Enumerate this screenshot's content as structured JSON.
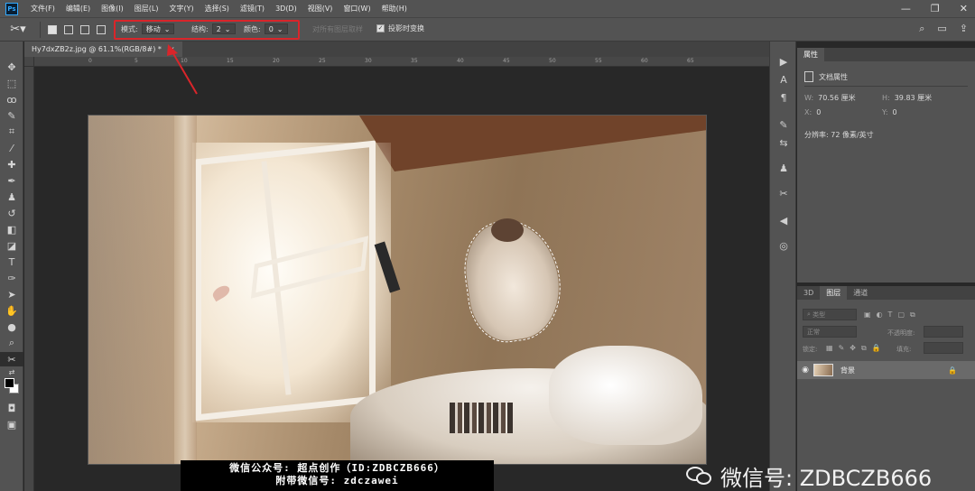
{
  "app": {
    "logo": "Ps",
    "menu": [
      "文件(F)",
      "编辑(E)",
      "图像(I)",
      "图层(L)",
      "文字(Y)",
      "选择(S)",
      "滤镜(T)",
      "3D(D)",
      "视图(V)",
      "窗口(W)",
      "帮助(H)"
    ]
  },
  "options": {
    "mode_label": "模式:",
    "mode_value": "移动",
    "structure_label": "结构:",
    "structure_value": "2",
    "color_label": "颜色:",
    "color_value": "0",
    "sample_all_layers": "对所有图层取样",
    "transform_on_drop_label": "投影时变换",
    "transform_on_drop_checked": true
  },
  "document": {
    "tab_title": "Hy7dxZB2z.jpg @ 61.1%(RGB/8#) *",
    "tab_close": "×",
    "ruler_ticks": [
      "0",
      "5",
      "10",
      "15",
      "20",
      "25",
      "30",
      "35",
      "40",
      "45",
      "50",
      "55",
      "60",
      "65"
    ]
  },
  "properties": {
    "tab_label": "属性",
    "section_title": "文档属性",
    "width_label": "W:",
    "width_value": "70.56 厘米",
    "height_label": "H:",
    "height_value": "39.83 厘米",
    "x_label": "X:",
    "x_value": "0",
    "y_label": "Y:",
    "y_value": "0",
    "resolution": "分辨率: 72 像素/英寸"
  },
  "layers": {
    "tabs": [
      "3D",
      "图层",
      "通道"
    ],
    "active_tab": "图层",
    "filter_placeholder": "类型",
    "blend_mode": "正常",
    "opacity_label": "不透明度:",
    "lock_label": "锁定:",
    "fill_label": "填充:",
    "layer_name": "背景"
  },
  "watermark": {
    "line1": "微信公众号: 超点创作（ID:ZDBCZB666）",
    "line2": "附带微信号: zdczawei",
    "right_text": "微信号: ZDBCZB666"
  },
  "colors": {
    "annotation_red": "#d9252a",
    "chrome": "#535353",
    "canvas_bg": "#282828"
  }
}
